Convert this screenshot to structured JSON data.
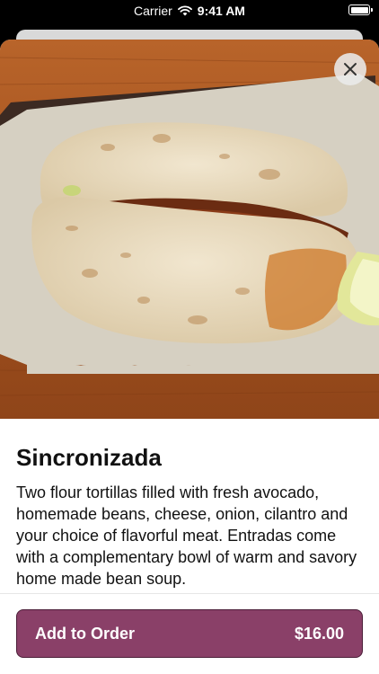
{
  "status_bar": {
    "carrier": "Carrier",
    "time": "9:41 AM"
  },
  "item": {
    "title": "Sincronizada",
    "description": "Two flour tortillas filled with fresh avocado, homemade beans, cheese, onion, cilantro and your choice of flavorful meat. Entradas come with a complementary bowl of warm and savory home made bean soup."
  },
  "action": {
    "label": "Add to Order",
    "price": "$16.00"
  },
  "colors": {
    "accent": "#8a4068",
    "accent_border": "#4a1d37"
  },
  "icons": {
    "close": "close-icon",
    "wifi": "wifi-icon",
    "battery": "battery-icon"
  }
}
